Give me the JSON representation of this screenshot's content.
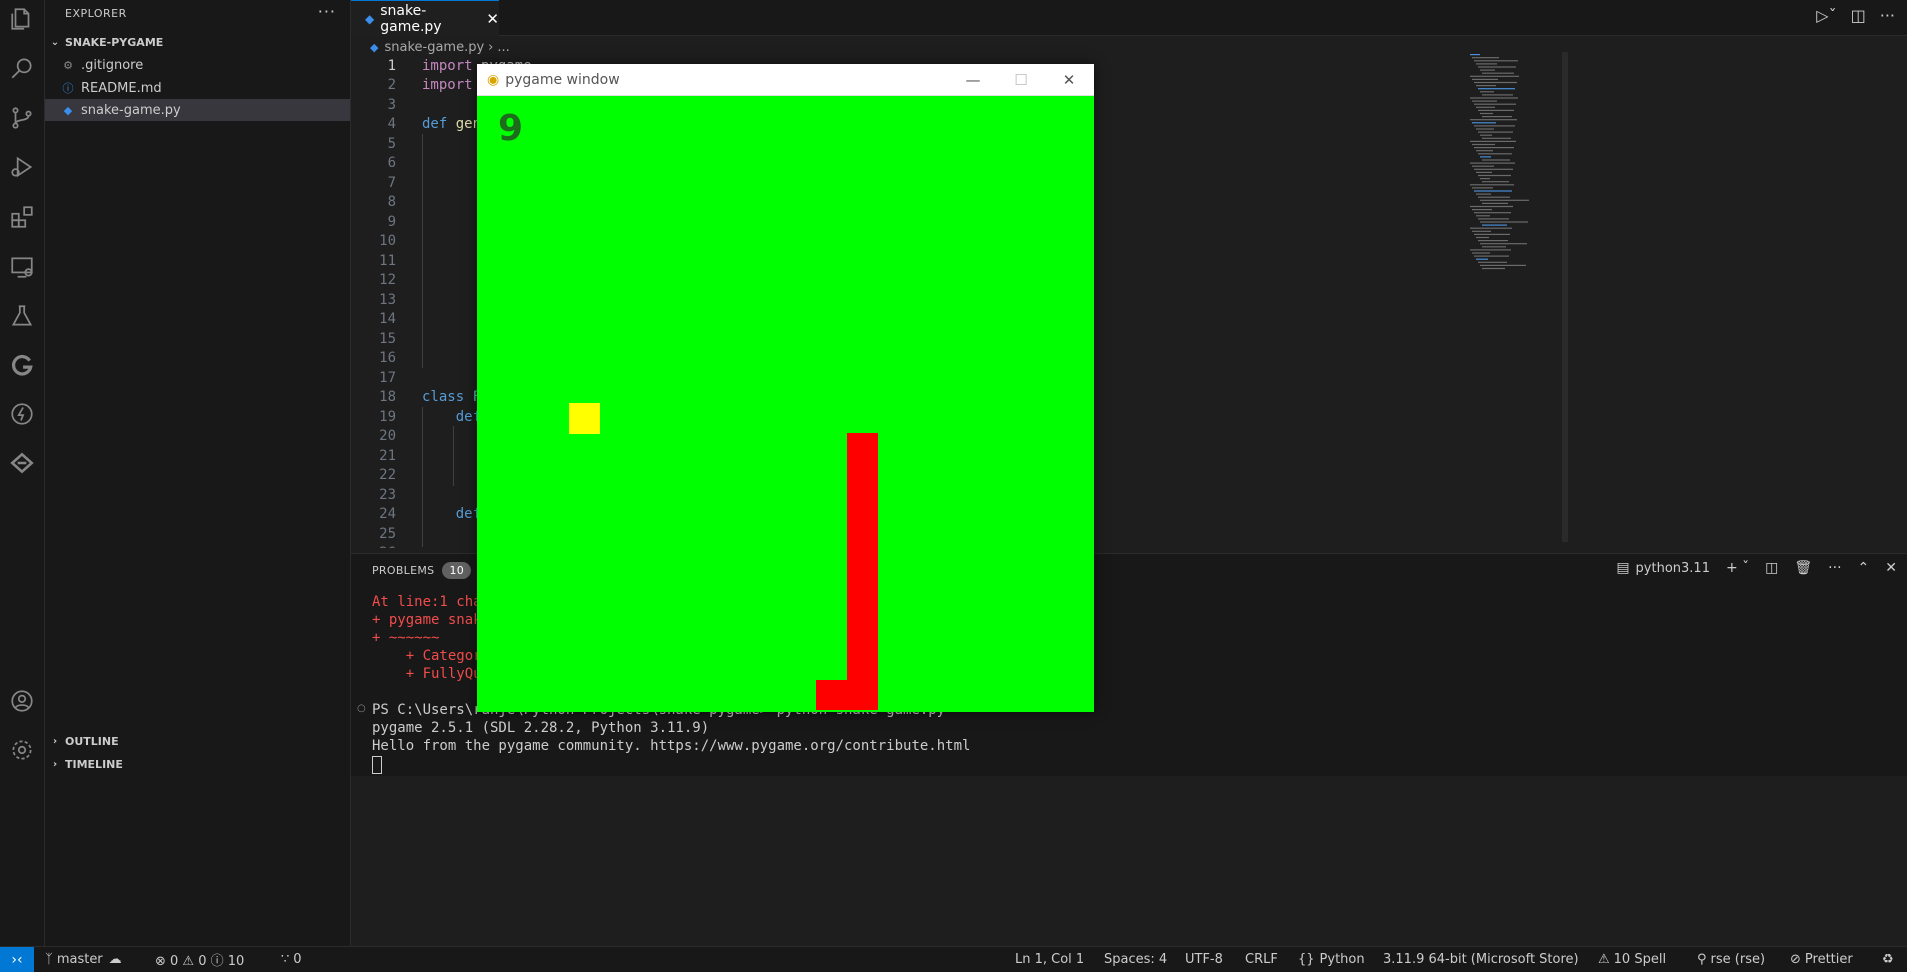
{
  "activity_bar": {
    "icons": [
      "explorer-icon",
      "search-icon",
      "source-control-icon",
      "run-debug-icon",
      "extensions-icon",
      "remote-explorer-icon",
      "testing-icon",
      "gitlens-icon",
      "thunder-client-icon",
      "codegpt-icon",
      "account-icon",
      "settings-gear-icon"
    ]
  },
  "sidebar": {
    "title": "EXPLORER",
    "more": "···",
    "project": "SNAKE-PYGAME",
    "files": [
      {
        "name": ".gitignore",
        "icon": "⚙"
      },
      {
        "name": "README.md",
        "icon": "ⓘ"
      },
      {
        "name": "snake-game.py",
        "icon": "◆"
      }
    ],
    "outline": "OUTLINE",
    "timeline": "TIMELINE"
  },
  "editor": {
    "tab_label": "snake-game.py",
    "breadcrumb_file": "snake-game.py",
    "breadcrumb_more": "...",
    "lines": [
      {
        "n": "1",
        "a": "import",
        "b": " pygame"
      },
      {
        "n": "2",
        "a": "import",
        "b": ""
      },
      {
        "n": "3",
        "a": "",
        "b": ""
      },
      {
        "n": "4",
        "a": "def",
        "b": " gen"
      },
      {
        "n": "5",
        "a": "",
        "b": ""
      },
      {
        "n": "6",
        "a": "",
        "b": ""
      },
      {
        "n": "7",
        "a": "",
        "b": ""
      },
      {
        "n": "8",
        "a": "",
        "b": ""
      },
      {
        "n": "9",
        "a": "",
        "b": ""
      },
      {
        "n": "10",
        "a": "",
        "b": ""
      },
      {
        "n": "11",
        "a": "",
        "b": ""
      },
      {
        "n": "12",
        "a": "",
        "b": ""
      },
      {
        "n": "13",
        "a": "",
        "b": ""
      },
      {
        "n": "14",
        "a": "",
        "b": ""
      },
      {
        "n": "15",
        "a": "",
        "b": ""
      },
      {
        "n": "16",
        "a": "",
        "b": ""
      },
      {
        "n": "17",
        "a": "",
        "b": ""
      },
      {
        "n": "18",
        "a": "class",
        "b": " F"
      },
      {
        "n": "19",
        "a": "    def",
        "b": ""
      },
      {
        "n": "20",
        "a": "",
        "b": ""
      },
      {
        "n": "21",
        "a": "",
        "b": ""
      },
      {
        "n": "22",
        "a": "",
        "b": ""
      },
      {
        "n": "23",
        "a": "",
        "b": ""
      },
      {
        "n": "24",
        "a": "    def",
        "b": ""
      },
      {
        "n": "25",
        "a": "",
        "b": ""
      },
      {
        "n": "26",
        "a": "",
        "b": ""
      }
    ]
  },
  "panel": {
    "tab_label": "PROBLEMS",
    "badge": "10",
    "terminal_name": "python3.11",
    "terminal_lines": [
      {
        "text": "At line:1 char",
        "kind": "err"
      },
      {
        "text": "+ pygame snake",
        "kind": "err"
      },
      {
        "text": "+ ~~~~~~",
        "kind": "err"
      },
      {
        "text": "    + Category",
        "kind": "err"
      },
      {
        "text": "    + FullyQua",
        "kind": "err"
      },
      {
        "text": "PS C:\\Users\\ranje\\Python Projects\\snake-pygame> python snake-game.py",
        "kind": "out"
      },
      {
        "text": "pygame 2.5.1 (SDL 2.28.2, Python 3.11.9)",
        "kind": "out"
      },
      {
        "text": "Hello from the pygame community. https://www.pygame.org/contribute.html",
        "kind": "out"
      }
    ]
  },
  "statusbar": {
    "branch": "master",
    "problems": "⊗ 0 ⚠ 0 ⓘ 10",
    "ports": "0",
    "position": "Ln 1, Col 1",
    "spaces": "Spaces: 4",
    "encoding": "UTF-8",
    "eol": "CRLF",
    "language": "Python",
    "interpreter": "3.11.9 64-bit (Microsoft Store)",
    "spell": "10 Spell",
    "rse": "rse (rse)",
    "prettier": "Prettier"
  },
  "pygame_window": {
    "title": "pygame window",
    "score": "9",
    "background": "#00ff00",
    "food_color": "#ffff00",
    "snake_color": "#ff0000",
    "score_color": "#1e6b1e"
  }
}
